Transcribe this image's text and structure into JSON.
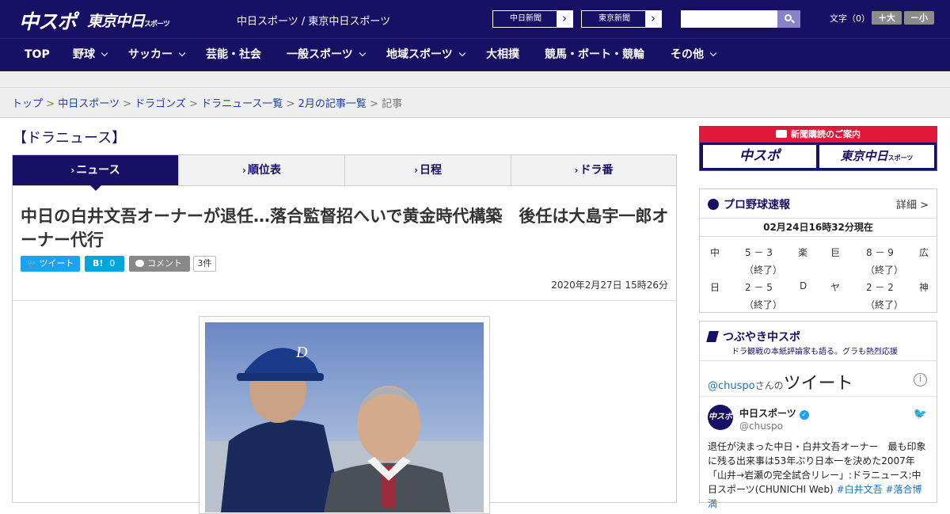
{
  "header": {
    "logo_chuspo": "中スポ",
    "logo_tokyo": "東京中日",
    "logo_tokyo_sub": "スポーツ",
    "site_name": "中日スポーツ / 東京中日スポーツ",
    "links": [
      {
        "label": "中日新聞",
        "arrow": "›"
      },
      {
        "label": "東京新聞",
        "arrow": "›"
      }
    ],
    "search": {
      "placeholder": "",
      "value": "",
      "icon": "search-icon"
    },
    "font_size": {
      "label": "文字（0）",
      "larger": "＋大",
      "smaller": "－小"
    }
  },
  "nav": {
    "items": [
      {
        "label": "TOP",
        "dropdown": false
      },
      {
        "label": "野球",
        "dropdown": true
      },
      {
        "label": "サッカー",
        "dropdown": true
      },
      {
        "label": "芸能・社会",
        "dropdown": false
      },
      {
        "label": "一般スポーツ",
        "dropdown": true
      },
      {
        "label": "地域スポーツ",
        "dropdown": true
      },
      {
        "label": "大相撲",
        "dropdown": false
      },
      {
        "label": "競馬・ボート・競輪",
        "dropdown": false
      },
      {
        "label": "その他",
        "dropdown": true
      }
    ]
  },
  "breadcrumb": {
    "items": [
      "トップ",
      "中日スポーツ",
      "ドラゴンズ",
      "ドラニュース一覧",
      "2月の記事一覧"
    ],
    "separator": ">",
    "current": "記事"
  },
  "section_title": "【ドラニュース】",
  "tabs": [
    {
      "label": "ニュース",
      "active": true
    },
    {
      "label": "順位表",
      "active": false
    },
    {
      "label": "日程",
      "active": false
    },
    {
      "label": "ドラ番",
      "active": false
    }
  ],
  "article": {
    "headline": "中日の白井文吾オーナーが退任…落合監督招へいで黄金時代構築　後任は大島宇一郎オーナー代行",
    "share": {
      "tweet_label": "ツイート",
      "hatena_label": "B!",
      "hatena_count": "0",
      "comment_label": "コメント",
      "comment_count": "3件"
    },
    "date": "2020年2月27日 15時26分"
  },
  "sidebar": {
    "subscription": {
      "header": "新聞購読のご案内",
      "logo_chuspo": "中スポ",
      "logo_tokyo": "東京中日",
      "logo_tokyo_sub": "スポーツ"
    },
    "baseball": {
      "title": "プロ野球速報",
      "more": "詳細 >",
      "updated": "02月24日16時32分現在",
      "games": [
        {
          "home": "中",
          "score": "5 － 3",
          "away": "楽",
          "status": "（終了）"
        },
        {
          "home": "巨",
          "score": "8 － 9",
          "away": "広",
          "status": "（終了）"
        },
        {
          "home": "日",
          "score": "2 － 5",
          "away": "D",
          "status": "（終了）"
        },
        {
          "home": "ヤ",
          "score": "2 － 2",
          "away": "神",
          "status": "（終了）"
        }
      ]
    },
    "tweets": {
      "title": "つぶやき中スポ",
      "subtitle": "ドラ観戦の本紙評論家も語る。グラも熱烈応援",
      "handle_link": "@chuspo",
      "handle_suffix": "さんの",
      "heading": "ツイート",
      "info_icon": "i",
      "account_name": "中日スポーツ",
      "account_handle": "@chuspo",
      "avatar_text": "中スポ",
      "tweet_text": "退任が決まった中日・白井文吾オーナー　最も印象に残る出来事は53年ぶり日本一を決めた2007年「山井→岩瀬の完全試合リレー」:ドラニュース:中日スポーツ(CHUNICHI Web) ",
      "hashtags": [
        "#白井文吾",
        "#落合博満"
      ]
    }
  },
  "colors": {
    "brand_navy": "#171064",
    "accent_red": "#e2183b",
    "link_blue": "#1f3fa8",
    "twitter_blue": "#1da1f2",
    "hatena_blue": "#00a4de"
  }
}
